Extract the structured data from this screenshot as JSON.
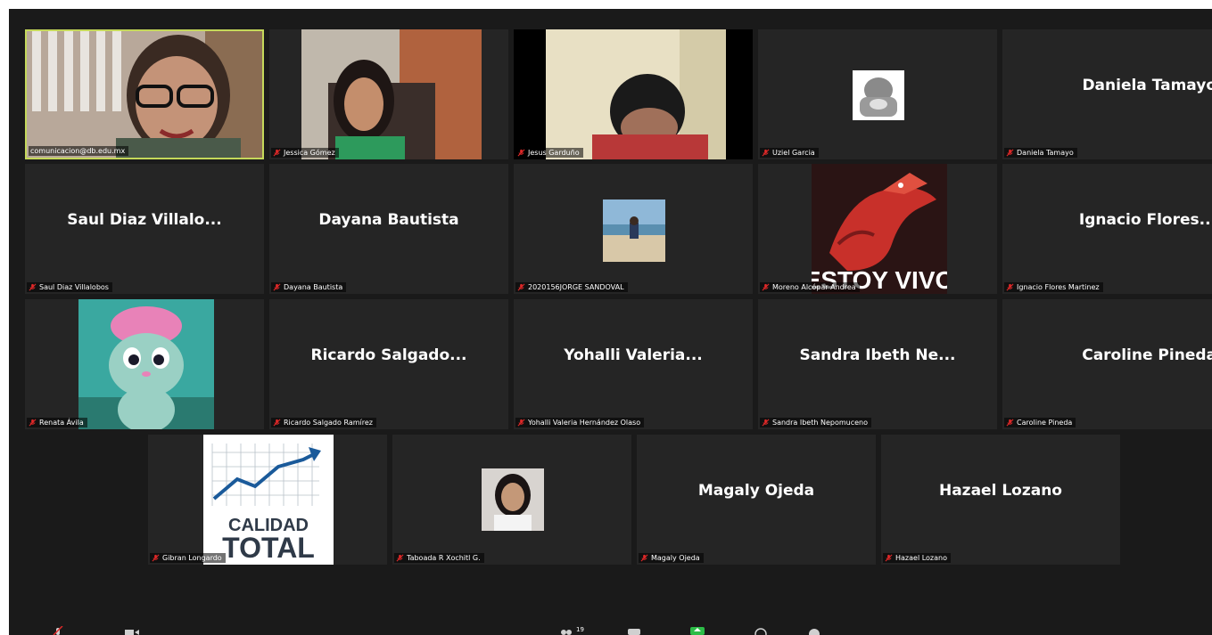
{
  "participants": [
    {
      "name": "comunicacion@db.edu.mx",
      "display": "",
      "type": "video",
      "muted": false
    },
    {
      "name": "Jessica Gómez",
      "display": "",
      "type": "video",
      "muted": true
    },
    {
      "name": "Jesus Garduño",
      "display": "",
      "type": "video",
      "muted": true
    },
    {
      "name": "Uziel Garcia",
      "display": "",
      "type": "avatar",
      "muted": true
    },
    {
      "name": "Daniela Tamayo",
      "display": "Daniela Tamayo",
      "type": "name",
      "muted": true
    },
    {
      "name": "Saul Diaz Villalobos",
      "display": "Saul Diaz Villalo...",
      "type": "name",
      "muted": true
    },
    {
      "name": "Dayana Bautista",
      "display": "Dayana Bautista",
      "type": "name",
      "muted": true
    },
    {
      "name": "2020156JORGE SANDOVAL",
      "display": "",
      "type": "avatar",
      "muted": true
    },
    {
      "name": "Moreno Alcópar Andrea",
      "display": "",
      "type": "avatar",
      "muted": true
    },
    {
      "name": "Ignacio Flores Martinez",
      "display": "Ignacio Flores...",
      "type": "name",
      "muted": true
    },
    {
      "name": "Renata Ávila",
      "display": "",
      "type": "avatar",
      "muted": true
    },
    {
      "name": "Ricardo Salgado Ramírez",
      "display": "Ricardo Salgado...",
      "type": "name",
      "muted": true
    },
    {
      "name": "Yohalli Valeria Hernández Olaso",
      "display": "Yohalli Valeria...",
      "type": "name",
      "muted": true
    },
    {
      "name": "Sandra Ibeth Nepomuceno",
      "display": "Sandra Ibeth Ne...",
      "type": "name",
      "muted": true
    },
    {
      "name": "Caroline Pineda",
      "display": "Caroline Pineda",
      "type": "name",
      "muted": true
    },
    {
      "name": "Gibran Longardo",
      "display": "",
      "type": "avatar",
      "muted": true
    },
    {
      "name": "Taboada R Xochitl G.",
      "display": "",
      "type": "avatar",
      "muted": true
    },
    {
      "name": "Magaly Ojeda",
      "display": "Magaly Ojeda",
      "type": "name",
      "muted": true
    },
    {
      "name": "Hazael Lozano",
      "display": "Hazael Lozano",
      "type": "name",
      "muted": true
    }
  ],
  "avatar_text": {
    "estoy_vivo": "ESTOY VIVO",
    "calidad": "CALIDAD",
    "total": "TOTAL"
  },
  "toolbar": {
    "participants_count": "19"
  },
  "colors": {
    "background": "#1a1a1a",
    "tile": "#252525",
    "active_speaker_border": "#c5d85a",
    "muted_icon": "#e02828",
    "share_button": "#2dbd48"
  }
}
